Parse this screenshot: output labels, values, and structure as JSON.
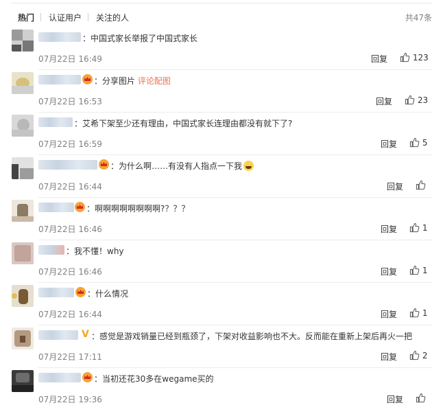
{
  "tabs": [
    "热门",
    "认证用户",
    "关注的人"
  ],
  "total": "共47条",
  "reply_label": "回复",
  "share_link": "评论配图",
  "comments": [
    {
      "text": "中国式家长举报了中国式家长",
      "time": "07月22日 16:49",
      "likes": "123"
    },
    {
      "text": "分享图片",
      "time": "07月22日 16:53",
      "likes": "23"
    },
    {
      "text": "艾希下架至少还有理由，中国式家长连理由都没有就下了?",
      "time": "07月22日 16:59",
      "likes": "5"
    },
    {
      "text": "为什么啊……有没有人指点一下我",
      "time": "07月22日 16:44",
      "likes": ""
    },
    {
      "text": "啊啊啊啊啊啊啊啊?？？？",
      "time": "07月22日 16:46",
      "likes": "1"
    },
    {
      "text": "我不懂！why",
      "time": "07月22日 16:46",
      "likes": "1"
    },
    {
      "text": "什么情况",
      "time": "07月22日 16:44",
      "likes": "1"
    },
    {
      "text": "感觉是游戏销量已经到瓶颈了，下架对收益影响也不大。反而能在重新上架后再火一把",
      "time": "07月22日 17:11",
      "likes": "2"
    },
    {
      "text": "当初还花30多在wegame买的",
      "time": "07月22日 19:36",
      "likes": ""
    }
  ],
  "colors": {
    "link": "#eb7350",
    "muted": "#808080",
    "badge_v": "#f5a623"
  }
}
